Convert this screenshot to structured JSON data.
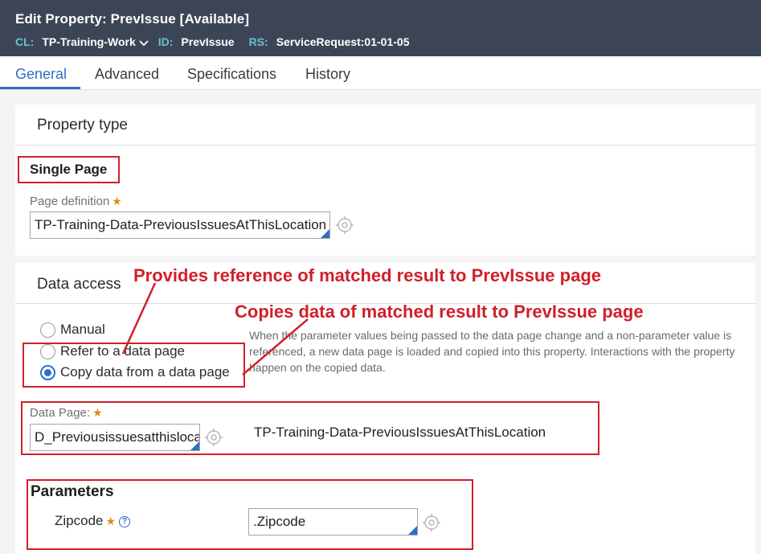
{
  "header": {
    "title": "Edit  Property: PrevIssue [Available]",
    "cl_label": "CL:",
    "cl_value": "TP-Training-Work",
    "id_label": "ID:",
    "id_value": "PrevIssue",
    "rs_label": "RS:",
    "rs_value": "ServiceRequest:01-01-05"
  },
  "tabs": [
    {
      "label": "General",
      "active": true
    },
    {
      "label": "Advanced"
    },
    {
      "label": "Specifications"
    },
    {
      "label": "History"
    }
  ],
  "property_type": {
    "section_title": "Property type",
    "mode": "Single Page",
    "page_definition_label": "Page definition",
    "page_definition_value": "TP-Training-Data-PreviousIssuesAtThisLocation"
  },
  "data_access": {
    "section_title": "Data access",
    "options": [
      {
        "label": "Manual",
        "checked": false
      },
      {
        "label": "Refer to a data page",
        "checked": false
      },
      {
        "label": "Copy data from a data page",
        "checked": true
      }
    ],
    "help_text": "When the parameter values being passed to the data page change and a non-parameter value is referenced, a new data page is loaded and copied into this property. Interactions with the property happen on the copied data.",
    "data_page_label": "Data Page:",
    "data_page_value": "D_Previousissuesatthislocation",
    "data_page_class": "TP-Training-Data-PreviousIssuesAtThisLocation"
  },
  "parameters": {
    "title": "Parameters",
    "items": [
      {
        "name": "Zipcode",
        "value": ".Zipcode"
      }
    ]
  },
  "annotations": {
    "refer": "Provides reference of matched result to PrevIssue page",
    "copy": "Copies data of matched result to PrevIssue page"
  },
  "colors": {
    "header_bg": "#3c4556",
    "accent": "#2f6ec6",
    "annotation_red": "#d0202a",
    "required_star": "#e08b1a"
  }
}
